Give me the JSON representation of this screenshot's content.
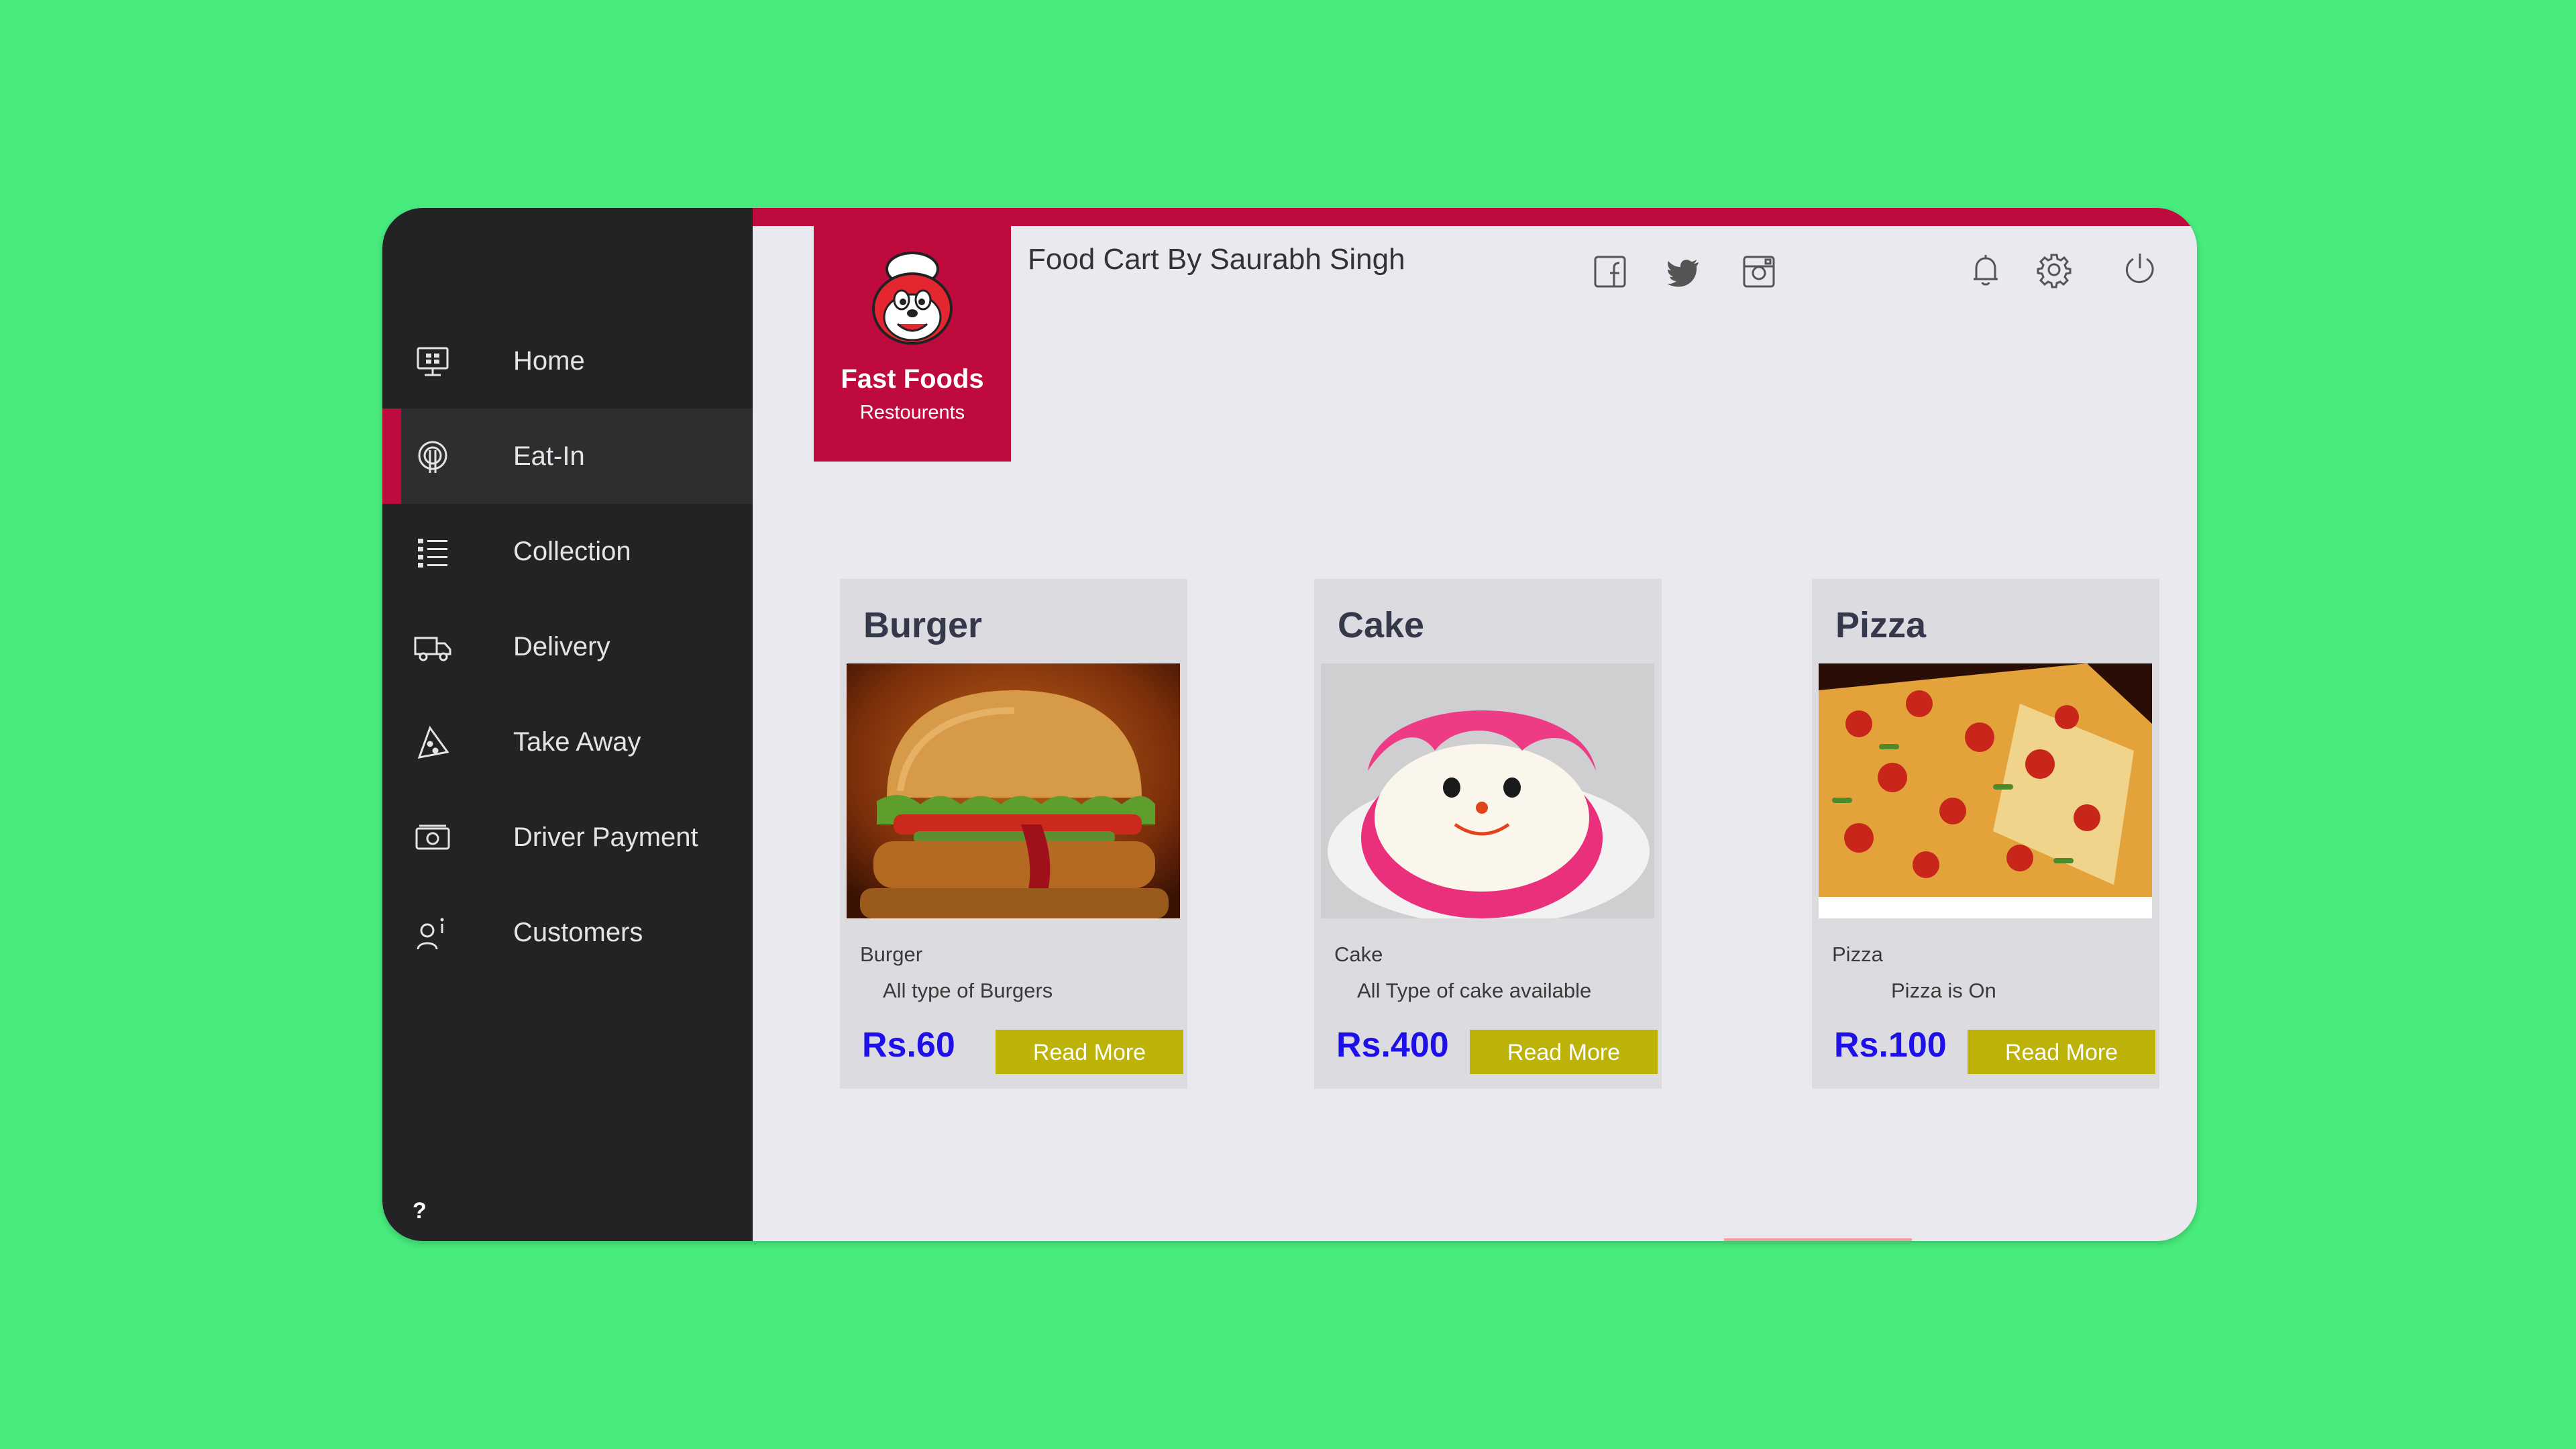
{
  "colors": {
    "background": "#48EB7D",
    "accent": "#BF0A3E",
    "sidebar": "#232224",
    "price": "#1E10E8",
    "button": "#BDB207"
  },
  "header": {
    "title": "Food Cart By Saurabh Singh",
    "social_icons": [
      "facebook-icon",
      "twitter-icon",
      "instagram-icon"
    ],
    "action_icons": [
      "bell-icon",
      "gear-icon",
      "power-icon"
    ]
  },
  "logo": {
    "brand": "Fast Foods",
    "subtitle": "Restourents"
  },
  "sidebar": {
    "items": [
      {
        "label": "Home",
        "icon": "monitor-icon"
      },
      {
        "label": "Eat-In",
        "icon": "dining-icon",
        "active": true
      },
      {
        "label": "Collection",
        "icon": "list-icon"
      },
      {
        "label": "Delivery",
        "icon": "truck-icon"
      },
      {
        "label": "Take Away",
        "icon": "pizza-slice-icon"
      },
      {
        "label": "Driver Payment",
        "icon": "cash-icon"
      },
      {
        "label": "Customers",
        "icon": "customer-info-icon"
      }
    ],
    "help": "?"
  },
  "cards": [
    {
      "title": "Burger",
      "name": "Burger",
      "description": "All type of Burgers",
      "price": "Rs.60",
      "button": "Read More"
    },
    {
      "title": "Cake",
      "name": "Cake",
      "description": "All Type of cake available",
      "price": "Rs.400",
      "button": "Read More"
    },
    {
      "title": "Pizza",
      "name": "Pizza",
      "description": "Pizza is On",
      "price": "Rs.100",
      "button": "Read More"
    }
  ]
}
